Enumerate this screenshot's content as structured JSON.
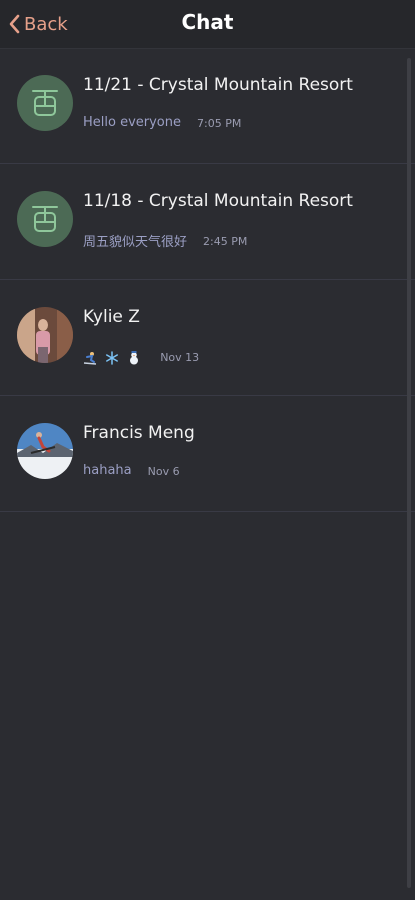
{
  "header": {
    "back_label": "Back",
    "title": "Chat"
  },
  "colors": {
    "accent": "#e6a08a",
    "background": "#2b2c31",
    "group_avatar": "#4c6a55",
    "preview_text": "#9b9fc4"
  },
  "chats": [
    {
      "name": "11/21 - Crystal Mountain Resort",
      "preview": "Hello everyone",
      "time": "7:05 PM",
      "avatar": "gondola-icon"
    },
    {
      "name": "11/18 - Crystal Mountain Resort",
      "preview": "周五貌似天气很好",
      "time": "2:45 PM",
      "avatar": "gondola-icon"
    },
    {
      "name": "Kylie Z",
      "preview_icons": [
        "skier-emoji",
        "snowflake-emoji",
        "snowman-emoji"
      ],
      "time": "Nov 13",
      "avatar": "user-photo"
    },
    {
      "name": "Francis Meng",
      "preview": "hahaha",
      "time": "Nov 6",
      "avatar": "user-photo"
    }
  ]
}
